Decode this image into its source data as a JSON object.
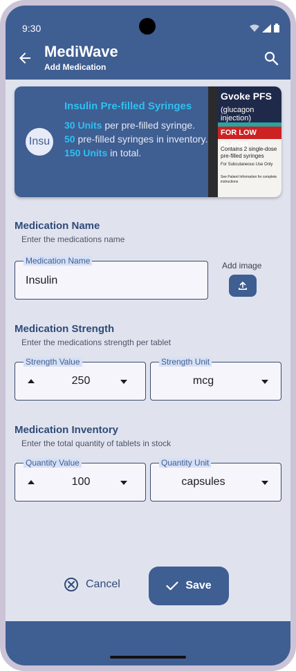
{
  "status_bar": {
    "time": "9:30"
  },
  "app_bar": {
    "title": "MediWave",
    "subtitle": "Add Medication"
  },
  "summary_card": {
    "title": "Insulin Pre-filled Syringes",
    "avatar_text": "Insu",
    "line1_highlight": "30 Units",
    "line1_rest": " per pre-filled syringe.",
    "line2_highlight": "50",
    "line2_rest": " pre-filled syringes in inventory.",
    "line3_highlight": "150 Units",
    "line3_rest": " in total.",
    "image": {
      "brand": "Gvoke",
      "brand_suffix": "PFS",
      "subtitle": "(glucagon injection)",
      "banner": "FOR LOW BLOOD",
      "line1": "Contains 2 single-dose pre-filled syringes",
      "line2": "For Subcutaneous Use Only",
      "line3": "See Patient Information for complete instructions"
    }
  },
  "name_section": {
    "title": "Medication Name",
    "subtitle": "Enter the medications name",
    "field_label": "Medication Name",
    "field_value": "Insulin",
    "add_image_label": "Add image"
  },
  "strength_section": {
    "title": "Medication Strength",
    "subtitle": "Enter the medications strength per tablet",
    "value_label": "Strength Value",
    "value": "250",
    "unit_label": "Strength Unit",
    "unit": "mcg"
  },
  "inventory_section": {
    "title": "Medication Inventory",
    "subtitle": "Enter the total quantity of tablets in stock",
    "value_label": "Quantity Value",
    "value": "100",
    "unit_label": "Quantity Unit",
    "unit": "capsules"
  },
  "actions": {
    "cancel_label": "Cancel",
    "save_label": "Save"
  },
  "colors": {
    "primary": "#3f5e92",
    "accent": "#2ec1f2",
    "background": "#e0e3ee",
    "frame": "#cbc3d6"
  }
}
